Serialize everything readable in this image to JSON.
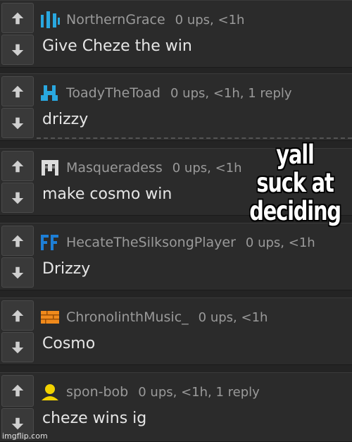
{
  "comments": [
    {
      "username": "NorthernGrace",
      "meta": "0 ups, <1h",
      "text": "Give Cheze the win",
      "avatar_icon": "blue-bars-icon",
      "avatar_color": "#29a8e0"
    },
    {
      "username": "ToadyTheToad",
      "meta": "0 ups, <1h, 1 reply",
      "text": "drizzy",
      "avatar_icon": "blue-pixel-figure-icon",
      "avatar_color": "#29a8e0"
    },
    {
      "username": "Masqueradess",
      "meta": "0 ups, <1h",
      "text": "make cosmo win",
      "avatar_icon": "gray-mask-icon",
      "avatar_color": "#dcdcdc"
    },
    {
      "username": "HecateTheSilksongPlayer",
      "meta": "0 ups, <1h",
      "text": "Drizzy",
      "avatar_icon": "blue-ff-icon",
      "avatar_color": "#1e7fd6"
    },
    {
      "username": "ChronolinthMusic_",
      "meta": "0 ups, <1h",
      "text": "Cosmo",
      "avatar_icon": "orange-bricks-icon",
      "avatar_color": "#f08a1c"
    },
    {
      "username": "spon-bob",
      "meta": "0 ups, <1h, 1 reply",
      "text": "cheze wins ig",
      "avatar_icon": "yellow-person-icon",
      "avatar_color": "#f2d200"
    }
  ],
  "overlay_text": "yall suck at deciding",
  "watermark": "imgflip.com"
}
